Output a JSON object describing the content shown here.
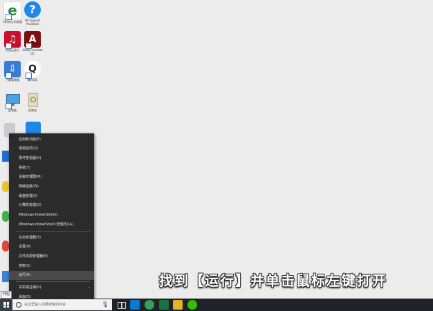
{
  "desktop": {
    "icons": [
      {
        "label": "360安全浏览器",
        "color": "#2e8b3d",
        "glyph": "e"
      },
      {
        "label": "HP Support Assistant",
        "color": "#1e88e5",
        "glyph": "?"
      },
      {
        "label": "网易云音乐",
        "color": "#c8102e",
        "glyph": "♫"
      },
      {
        "label": "Adobe Acrobat DC",
        "color": "#7a1010",
        "glyph": "A"
      },
      {
        "label": "下载管理器",
        "color": "#3a7bd5",
        "glyph": "⇩"
      },
      {
        "label": "腾讯QQ",
        "color": "#222222",
        "glyph": "Q"
      },
      {
        "label": "此电脑",
        "color": "#4aa3df",
        "glyph": "▭"
      },
      {
        "label": "回收站",
        "color": "#d9c9a6",
        "glyph": "◫"
      }
    ]
  },
  "context_menu": {
    "items": [
      {
        "label": "应用和功能(F)"
      },
      {
        "label": "电源选项(O)"
      },
      {
        "label": "事件查看器(V)"
      },
      {
        "label": "系统(Y)"
      },
      {
        "label": "设备管理器(M)"
      },
      {
        "label": "网络连接(W)"
      },
      {
        "label": "磁盘管理(K)"
      },
      {
        "label": "计算机管理(G)"
      },
      {
        "label": "Windows PowerShell(I)"
      },
      {
        "label": "Windows PowerShell (管理员)(A)"
      },
      {
        "label": "任务管理器(T)"
      },
      {
        "label": "设置(N)"
      },
      {
        "label": "文件资源管理器(E)"
      },
      {
        "label": "搜索(S)"
      },
      {
        "label": "运行(R)",
        "highlighted": true
      },
      {
        "label": "关机或注销(U)",
        "has_submenu": true
      },
      {
        "label": "桌面(D)"
      }
    ]
  },
  "caption": "找到【运行】并单击鼠标左键打开",
  "taskbar": {
    "search_placeholder": "在这里输入你要搜索的内容",
    "tooltip": "开始",
    "apps": [
      {
        "name": "task-view",
        "color": "#3b3f45"
      },
      {
        "name": "store",
        "color": "#0a78d4"
      },
      {
        "name": "360-browser",
        "color": "#31a354"
      },
      {
        "name": "excel",
        "color": "#1d7044"
      },
      {
        "name": "file-explorer",
        "color": "#e6b422"
      },
      {
        "name": "wechat",
        "color": "#2dc100"
      }
    ]
  }
}
